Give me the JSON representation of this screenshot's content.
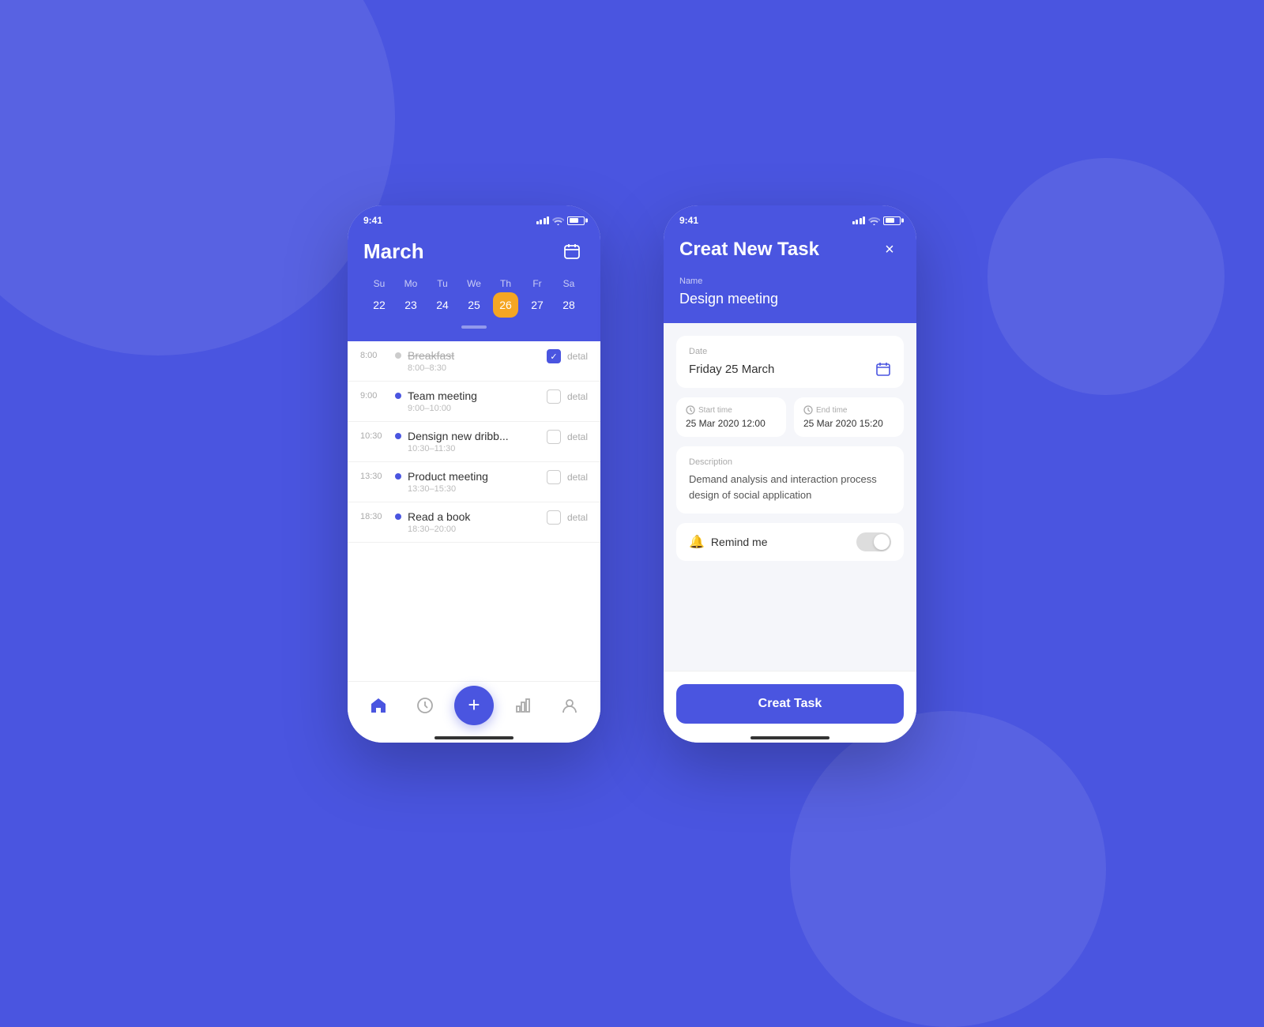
{
  "background_color": "#4A55E0",
  "phone1": {
    "status_bar": {
      "time": "9:41"
    },
    "header": {
      "month": "March",
      "calendar_icon": "📅"
    },
    "calendar": {
      "headers": [
        "Su",
        "Mo",
        "Tu",
        "We",
        "Th",
        "Fr",
        "Sa"
      ],
      "days": [
        22,
        23,
        24,
        25,
        26,
        27,
        28
      ],
      "active_day": 26
    },
    "tasks": [
      {
        "time": "8:00",
        "title": "Breakfast",
        "duration": "8:00–8:30",
        "checked": true,
        "strikethrough": true,
        "dot": "gray"
      },
      {
        "time": "9:00",
        "title": "Team meeting",
        "duration": "9:00–10:00",
        "checked": false,
        "dot": "blue"
      },
      {
        "time": "10:30",
        "title": "Densign new dribb...",
        "duration": "10:30–11:30",
        "checked": false,
        "dot": "blue"
      },
      {
        "time": "13:30",
        "title": "Product meeting",
        "duration": "13:30–15:30",
        "checked": false,
        "dot": "blue"
      },
      {
        "time": "18:30",
        "title": "Read a book",
        "duration": "18:30–20:00",
        "checked": false,
        "dot": "blue"
      }
    ],
    "nav": {
      "home_label": "🏠",
      "clock_label": "🕐",
      "fab_label": "+",
      "chart_label": "📊",
      "profile_label": "👤"
    }
  },
  "phone2": {
    "status_bar": {
      "time": "9:41"
    },
    "header": {
      "title": "Creat New Task",
      "close": "×",
      "name_label": "Name",
      "name_value": "Design meeting"
    },
    "date_section": {
      "label": "Date",
      "value": "Friday 25 March"
    },
    "start_time": {
      "label": "Start time",
      "value": "25 Mar 2020  12:00"
    },
    "end_time": {
      "label": "End time",
      "value": "25 Mar 2020  15:20"
    },
    "description": {
      "label": "Description",
      "value": "Demand analysis and interaction process design of social application"
    },
    "remind": {
      "label": "Remind me",
      "enabled": false
    },
    "create_button": "Creat Task"
  }
}
